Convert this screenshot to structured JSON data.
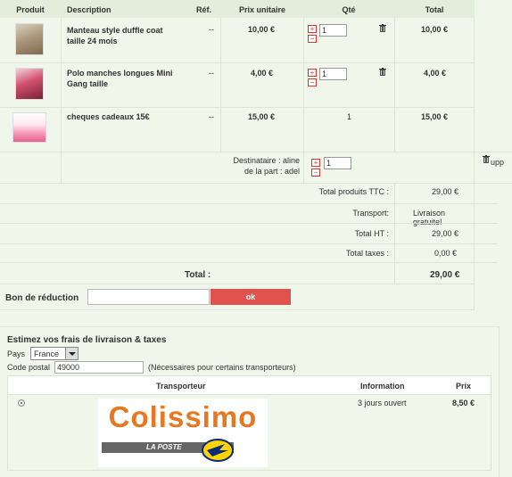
{
  "cart": {
    "headers": {
      "product": "Produit",
      "description": "Description",
      "ref": "Réf.",
      "unit_price": "Prix unitaire",
      "qty": "Qté",
      "total": "Total"
    },
    "rows": [
      {
        "description": "Manteau style duffle coat taille 24 mois",
        "ref": "--",
        "unit_price": "10,00 €",
        "qty": "1",
        "total": "10,00 €"
      },
      {
        "description": "Polo manches longues Mini Gang taille",
        "ref": "--",
        "unit_price": "4,00 €",
        "qty": "1",
        "total": "4,00 €"
      },
      {
        "description": "cheques cadeaux 15€",
        "ref": "--",
        "unit_price": "15,00 €",
        "qty": "1",
        "total": "15,00 €"
      }
    ],
    "gift": {
      "recipient": "Destinataire : aline",
      "from": "de la part : adel",
      "qty": "1",
      "delete_label": "upp"
    },
    "summary": {
      "ttc_label": "Total produits TTC :",
      "ttc_value": "29,00 €",
      "transport_label": "Transport:",
      "transport_value": "Livraison gratuite!",
      "ht_label": "Total HT :",
      "ht_value": "29,00 €",
      "taxes_label": "Total taxes :",
      "taxes_value": "0,00 €",
      "total_label": "Total :",
      "total_value": "29,00 €"
    }
  },
  "discount": {
    "label": "Bon de réduction",
    "input_value": "",
    "button_label": "ok"
  },
  "shipping": {
    "title": "Estimez vos frais de livraison & taxes",
    "country_label": "Pays",
    "country_value": "France",
    "postal_label": "Code postal",
    "postal_value": "49000",
    "postal_hint": "(Nécessaires pour certains transporteurs)",
    "headers": {
      "carrier": "Transporteur",
      "info": "Information",
      "price": "Prix"
    },
    "carrier": {
      "logo_text": "Colissimo",
      "logo_sub": "LA POSTE",
      "info": "3 jours ouvert",
      "price": "8,50 €"
    }
  },
  "colors": {
    "background": "#f0f6e9",
    "header": "#e3eddb",
    "ok_button": "#e0534d",
    "logo_orange": "#e87722"
  }
}
